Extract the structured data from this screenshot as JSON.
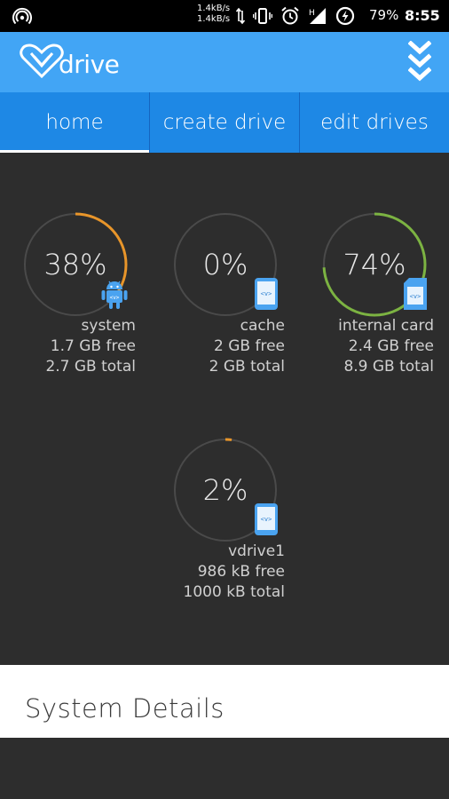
{
  "status_bar": {
    "net_speed_up": "1.4kB/s",
    "net_speed_down": "1.4kB/s",
    "battery_percent": "79%",
    "time": "8:55"
  },
  "app": {
    "name": "drive",
    "brand_color": "#42a5f5",
    "tab_bar_color": "#1e88e5"
  },
  "tabs": [
    {
      "label": "home",
      "active": true
    },
    {
      "label": "create drive",
      "active": false
    },
    {
      "label": "edit drives",
      "active": false
    }
  ],
  "drives": [
    {
      "name": "system",
      "percent_text": "38%",
      "percent": 38,
      "ring_color": "#e8952a",
      "icon": "android-icon",
      "free": "1.7 GB free",
      "total": "2.7 GB total"
    },
    {
      "name": "cache",
      "percent_text": "0%",
      "percent": 0,
      "ring_color": "#e8952a",
      "icon": "phone-icon",
      "free": "2 GB free",
      "total": "2 GB total"
    },
    {
      "name": "internal card",
      "percent_text": "74%",
      "percent": 74,
      "ring_color": "#7cb342",
      "icon": "sd-card-icon",
      "free": "2.4 GB free",
      "total": "8.9 GB total"
    },
    {
      "name": "vdrive1",
      "percent_text": "2%",
      "percent": 2,
      "ring_color": "#e8952a",
      "icon": "phone-icon",
      "free": "986 kB free",
      "total": "1000 kB total"
    }
  ],
  "details": {
    "title": "System Details"
  }
}
